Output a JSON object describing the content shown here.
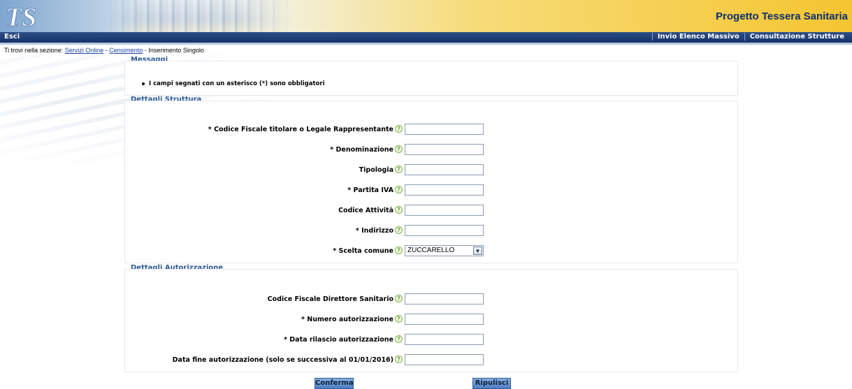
{
  "header": {
    "logo_text": "TS",
    "app_title": "Progetto Tessera Sanitaria"
  },
  "nav": {
    "logout": "Esci",
    "links": [
      "Invio Elenco Massivo",
      "Consultazione Strutture"
    ]
  },
  "breadcrumb": {
    "prefix": "Ti trovi nella sezione:",
    "crumbs": [
      "Servizi Online",
      "Censimento"
    ],
    "current": "Inserimento Singolo",
    "separator": "-"
  },
  "messages": {
    "title": "Messaggi",
    "items": [
      "I campi segnati con un asterisco (*) sono obbligatori"
    ]
  },
  "struttura": {
    "title": "Dettagli Struttura",
    "fields": [
      {
        "label": "* Codice Fiscale titolare o Legale Rappresentante",
        "value": ""
      },
      {
        "label": "* Denominazione",
        "value": ""
      },
      {
        "label": "Tipologia",
        "value": ""
      },
      {
        "label": "* Partita IVA",
        "value": ""
      },
      {
        "label": "Codice Attività",
        "value": ""
      },
      {
        "label": "* Indirizzo",
        "value": ""
      },
      {
        "label": "* Scelta comune",
        "value": "ZUCCARELLO"
      }
    ]
  },
  "autorizzazione": {
    "title": "Dettagli Autorizzazione",
    "fields": [
      {
        "label": "Codice Fiscale Direttore Sanitario",
        "value": ""
      },
      {
        "label": "* Numero autorizzazione",
        "value": ""
      },
      {
        "label": "* Data rilascio autorizzazione",
        "value": ""
      },
      {
        "label": "Data fine autorizzazione (solo se successiva al 01/01/2016)",
        "value": ""
      }
    ]
  },
  "help_glyph": "?",
  "select_arrow": "▼",
  "actions": {
    "confirm": "Conferma",
    "reset": "Ripulisci"
  },
  "colors": {
    "navbar": "#15326a",
    "title": "#0b2d6b",
    "section_title": "#2d5a95",
    "button": "#4d7fc4",
    "help": "#6fa33a"
  }
}
